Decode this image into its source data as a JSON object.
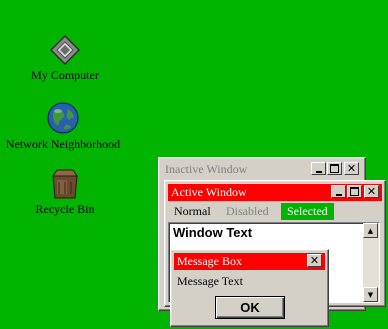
{
  "colors": {
    "desktop": "#00b400",
    "active_title": "#ff0000",
    "inactive_title": "#d4d0c8",
    "selected_menu": "#00b400",
    "window_face": "#d4d0c8"
  },
  "desktop_icons": [
    {
      "label": "My Computer",
      "icon": "computer-icon"
    },
    {
      "label": "Network Neighborhood",
      "icon": "globe-icon"
    },
    {
      "label": "Recycle Bin",
      "icon": "recycle-bin-icon"
    }
  ],
  "inactive_window": {
    "title": "Inactive Window"
  },
  "active_window": {
    "title": "Active Window",
    "menu": {
      "normal": "Normal",
      "disabled": "Disabled",
      "selected": "Selected"
    },
    "window_text": "Window Text"
  },
  "message_box": {
    "title": "Message Box",
    "text": "Message Text",
    "ok_label": "OK"
  }
}
